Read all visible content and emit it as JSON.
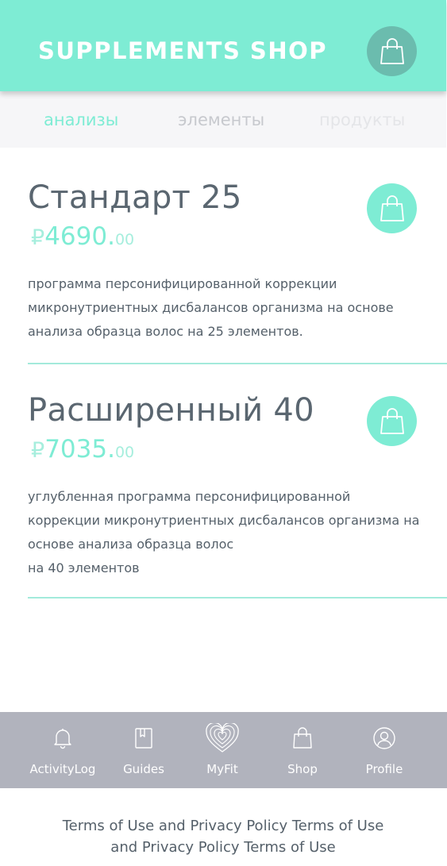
{
  "header": {
    "title": "SUPPLEMENTS SHOP",
    "cart_icon": "shopping-bag-icon"
  },
  "tabs": [
    {
      "label": "анализы",
      "active": true
    },
    {
      "label": "элементы",
      "active": false
    },
    {
      "label": "продукты",
      "active": false
    }
  ],
  "products": [
    {
      "name": "Стандарт 25",
      "currency": "₽",
      "price_main": "4690",
      "price_dot": ".",
      "price_cents": "00",
      "description_lines": [
        "программа персонифицированной коррекции",
        "микронутриентных дисбалансов организма на основе",
        "анализа образца волос на 25 элементов."
      ],
      "add_icon": "shopping-bag-icon"
    },
    {
      "name": "Расширенный 40",
      "currency": "₽",
      "price_main": "7035",
      "price_dot": ".",
      "price_cents": "00",
      "description_lines": [
        "углубленная программа персонифицированной",
        "коррекции микронутриентных дисбалансов организма на",
        "основе анализа образца волос",
        "на 40 элементов"
      ],
      "add_icon": "shopping-bag-icon"
    }
  ],
  "bottom_nav": [
    {
      "label": "ActivityLog",
      "icon": "bell-icon"
    },
    {
      "label": "Guides",
      "icon": "book-icon"
    },
    {
      "label": "MyFit",
      "icon": "fingerprint-heart-icon"
    },
    {
      "label": "Shop",
      "icon": "shopping-bag-icon"
    },
    {
      "label": "Profile",
      "icon": "user-circle-icon"
    }
  ],
  "footer": {
    "text": "Terms of Use and Privacy Policy Terms of Use and Privacy Policy Terms of Use"
  },
  "colors": {
    "accent": "#7eecd4",
    "header_cart_bg": "#6bbcae",
    "tabs_bg": "#f6f6f8",
    "nav_bg": "#b1b3bd",
    "text": "#55606a"
  }
}
